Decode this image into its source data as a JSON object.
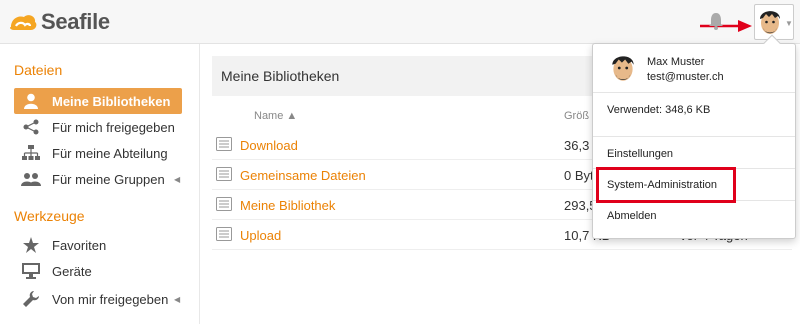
{
  "header": {
    "logo_text": "Seafile",
    "brand_color": "#eb8205"
  },
  "sidebar": {
    "files_heading": "Dateien",
    "tools_heading": "Werkzeuge",
    "items": [
      {
        "label": "Meine Bibliotheken",
        "icon": "user-icon",
        "active": true
      },
      {
        "label": "Für mich freigegeben",
        "icon": "share-icon"
      },
      {
        "label": "Für meine Abteilung",
        "icon": "org-chart-icon"
      },
      {
        "label": "Für meine Gruppen",
        "icon": "group-icon"
      }
    ],
    "tools": [
      {
        "label": "Favoriten",
        "icon": "star-icon"
      },
      {
        "label": "Geräte",
        "icon": "monitor-icon"
      },
      {
        "label": "Von mir freigegeben",
        "icon": "wrench-icon"
      }
    ]
  },
  "main": {
    "title": "Meine Bibliotheken",
    "columns": {
      "name": "Name ▲",
      "size": "Größ"
    },
    "rows": [
      {
        "name": "Download",
        "size": "36,3",
        "time": ""
      },
      {
        "name": "Gemeinsame Dateien",
        "size": "0 Byt",
        "time": ""
      },
      {
        "name": "Meine Bibliothek",
        "size": "293,5",
        "time": ""
      },
      {
        "name": "Upload",
        "size": "10,7 KB",
        "time": "vor 4 Tagen"
      }
    ]
  },
  "user_menu": {
    "name": "Max Muster",
    "email": "test@muster.ch",
    "usage": "Verwendet: 348,6 KB",
    "items": [
      "Einstellungen",
      "System-Administration",
      "Abmelden"
    ],
    "highlight_color": "#e0001b"
  }
}
